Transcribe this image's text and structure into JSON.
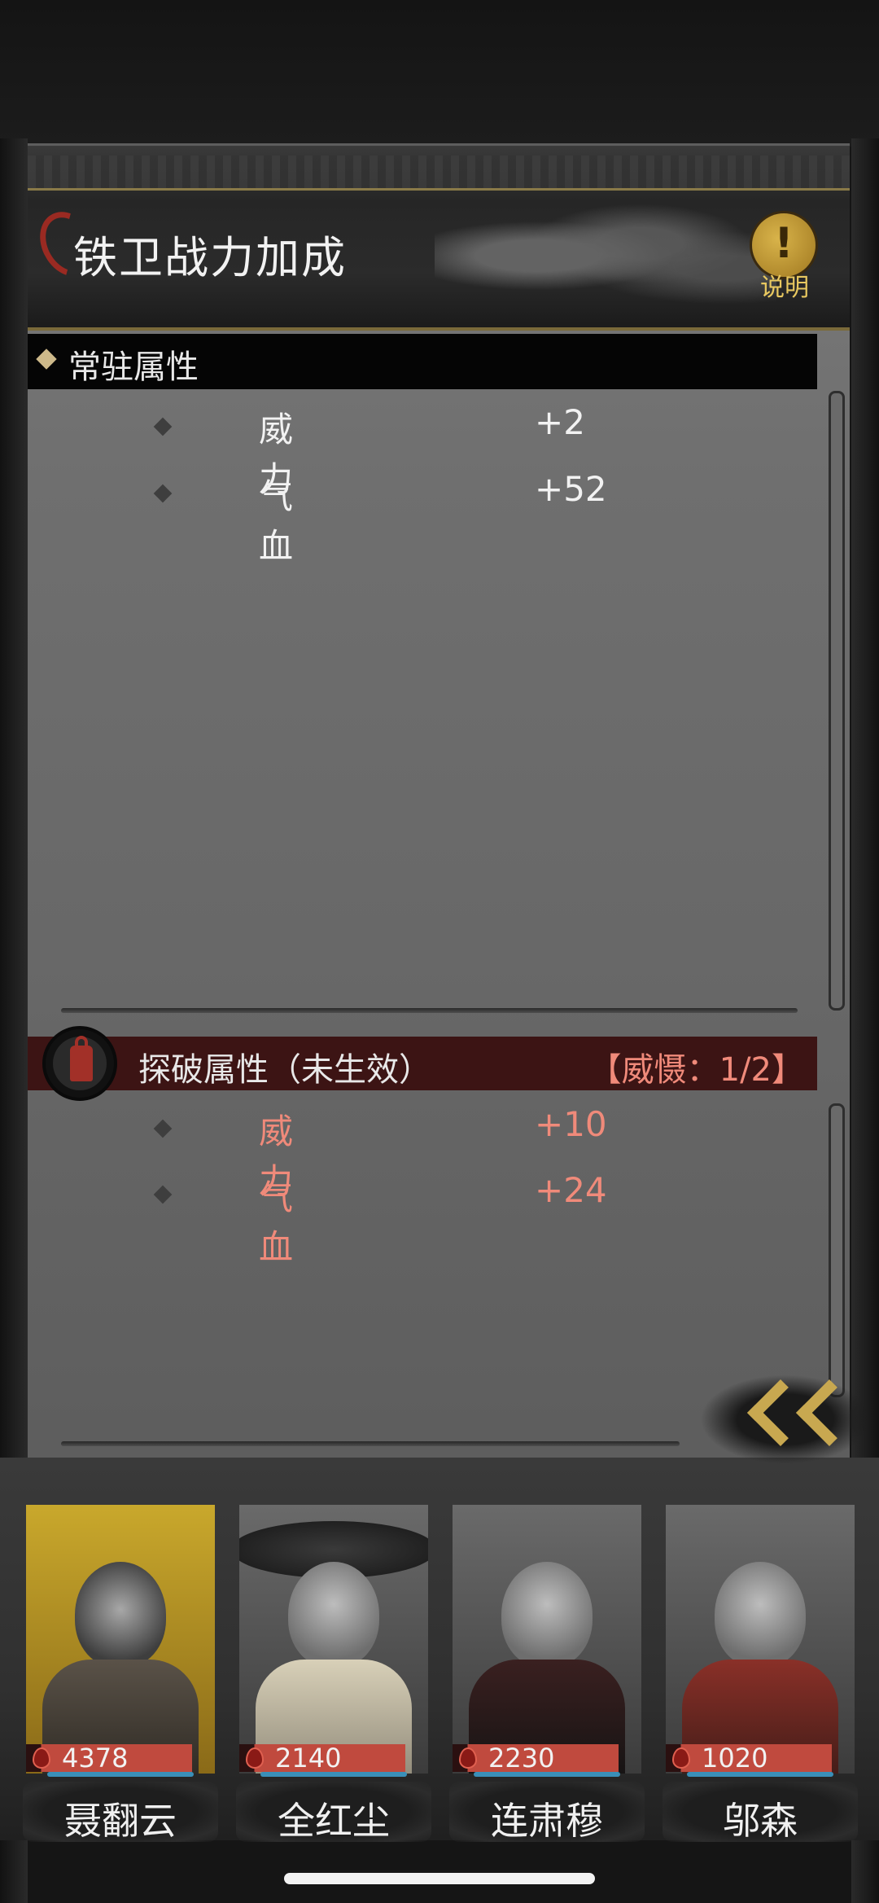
{
  "header": {
    "title": "铁卫战力加成",
    "help_label": "说明"
  },
  "permanent": {
    "title": "常驻属性",
    "stats": [
      {
        "name": "威力",
        "value": "+2"
      },
      {
        "name": "气血",
        "value": "+52"
      }
    ]
  },
  "breakthrough": {
    "title": "探破属性（未生效）",
    "status": "【威慑：1/2】",
    "stats": [
      {
        "name": "威力",
        "value": "+10"
      },
      {
        "name": "气血",
        "value": "+24"
      }
    ]
  },
  "characters": [
    {
      "name": "聂翻云",
      "power": "4378",
      "selected": true
    },
    {
      "name": "全红尘",
      "power": "2140",
      "selected": false
    },
    {
      "name": "连肃穆",
      "power": "2230",
      "selected": false
    },
    {
      "name": "邬森",
      "power": "1020",
      "selected": false
    }
  ],
  "colors": {
    "accent_gold": "#c8a850",
    "inactive_red": "#f08a7a",
    "section_red": "#3c1414"
  }
}
